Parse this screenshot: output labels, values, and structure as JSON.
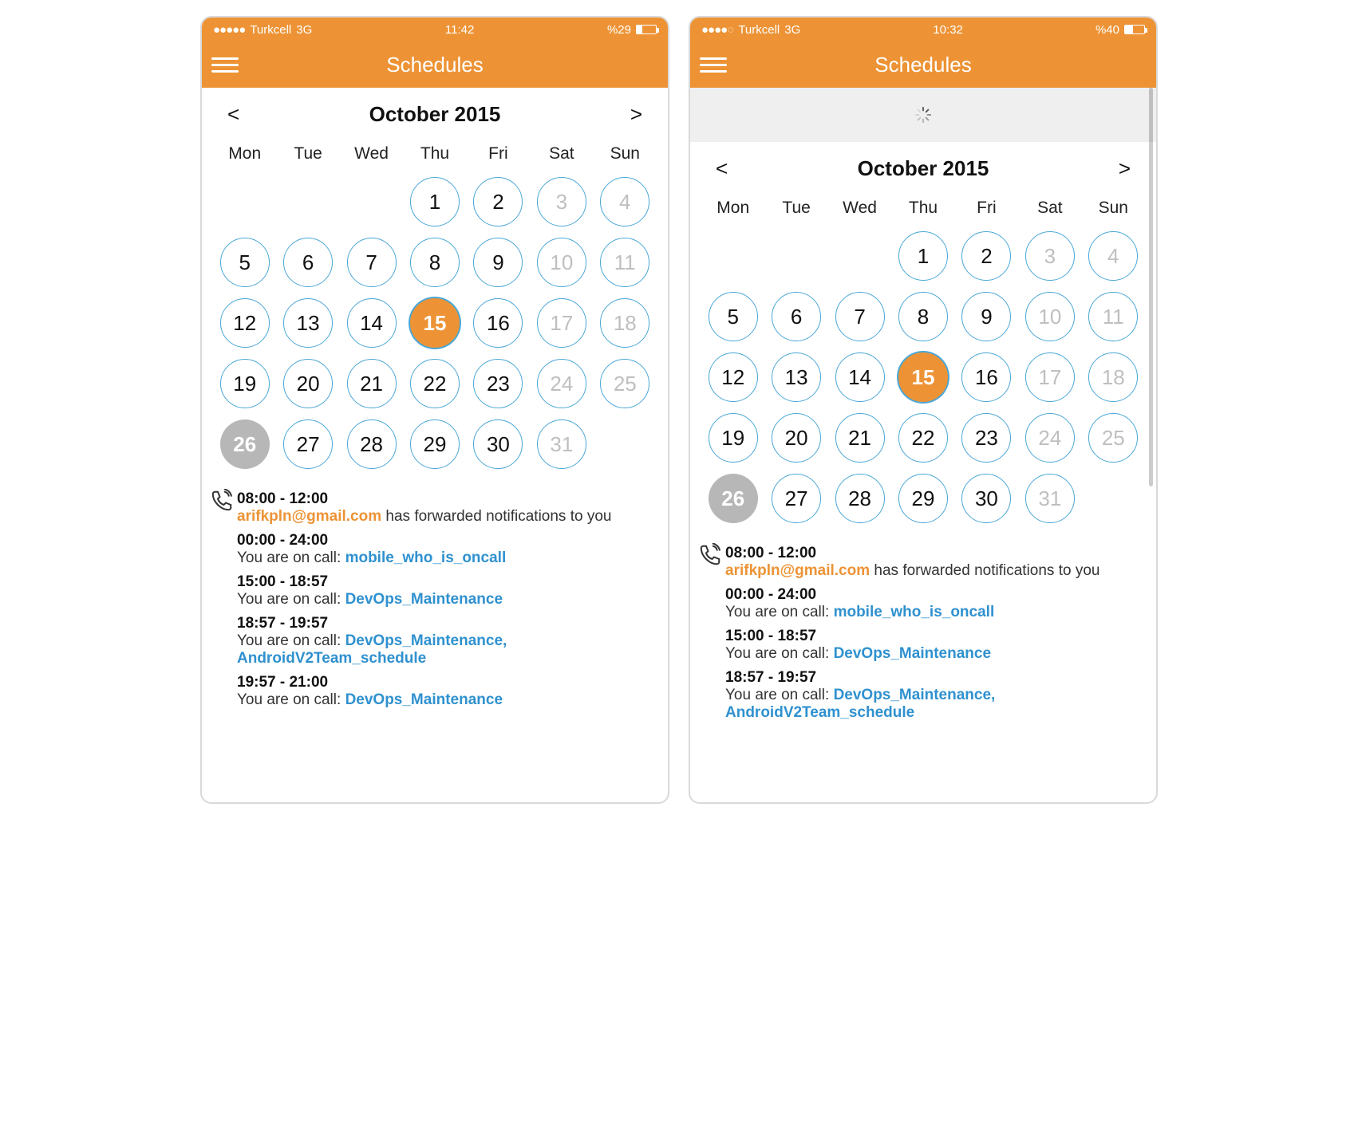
{
  "colors": {
    "accent": "#ed9335",
    "link": "#2f91cf",
    "ring": "#4aa7d6"
  },
  "screens": {
    "left": {
      "status": {
        "carrier": "Turkcell",
        "network": "3G",
        "time": "11:42",
        "battery_label": "%29",
        "battery_pct": 29,
        "signal_filled": 5
      },
      "nav_title": "Schedules",
      "month_title": "October 2015",
      "has_loading": false,
      "events": [
        {
          "time": "08:00 - 12:00",
          "segments": [
            {
              "t": "arifkpln@gmail.com",
              "c": "orange"
            },
            {
              "t": " has forwarded notifications to you",
              "c": ""
            }
          ]
        },
        {
          "time": "00:00 - 24:00",
          "segments": [
            {
              "t": "You are on call: ",
              "c": ""
            },
            {
              "t": "mobile_who_is_oncall",
              "c": "blue"
            }
          ]
        },
        {
          "time": "15:00 - 18:57",
          "segments": [
            {
              "t": "You are on call: ",
              "c": ""
            },
            {
              "t": "DevOps_Maintenance",
              "c": "blue"
            }
          ]
        },
        {
          "time": "18:57 - 19:57",
          "segments": [
            {
              "t": "You are on call: ",
              "c": ""
            },
            {
              "t": "DevOps_Maintenance, AndroidV2Team_schedule",
              "c": "blue"
            }
          ]
        },
        {
          "time": "19:57 - 21:00",
          "segments": [
            {
              "t": "You are on call: ",
              "c": ""
            },
            {
              "t": "DevOps_Maintenance",
              "c": "blue"
            }
          ]
        }
      ]
    },
    "right": {
      "status": {
        "carrier": "Turkcell",
        "network": "3G",
        "time": "10:32",
        "battery_label": "%40",
        "battery_pct": 40,
        "signal_filled": 4
      },
      "nav_title": "Schedules",
      "month_title": "October 2015",
      "has_loading": true,
      "events": [
        {
          "time": "08:00 - 12:00",
          "segments": [
            {
              "t": "arifkpln@gmail.com",
              "c": "orange"
            },
            {
              "t": " has forwarded notifications to you",
              "c": ""
            }
          ]
        },
        {
          "time": "00:00 - 24:00",
          "segments": [
            {
              "t": "You are on call: ",
              "c": ""
            },
            {
              "t": "mobile_who_is_oncall",
              "c": "blue"
            }
          ]
        },
        {
          "time": "15:00 - 18:57",
          "segments": [
            {
              "t": "You are on call: ",
              "c": ""
            },
            {
              "t": "DevOps_Maintenance",
              "c": "blue"
            }
          ]
        },
        {
          "time": "18:57 - 19:57",
          "segments": [
            {
              "t": "You are on call: ",
              "c": ""
            },
            {
              "t": "DevOps_Maintenance, AndroidV2Team_schedule",
              "c": "blue"
            }
          ]
        }
      ]
    }
  },
  "dow": [
    "Mon",
    "Tue",
    "Wed",
    "Thu",
    "Fri",
    "Sat",
    "Sun"
  ],
  "calendar": {
    "leading_blanks": 3,
    "days": [
      {
        "n": "1",
        "weekend": false
      },
      {
        "n": "2",
        "weekend": false
      },
      {
        "n": "3",
        "weekend": true
      },
      {
        "n": "4",
        "weekend": true
      },
      {
        "n": "5",
        "weekend": false
      },
      {
        "n": "6",
        "weekend": false
      },
      {
        "n": "7",
        "weekend": false
      },
      {
        "n": "8",
        "weekend": false
      },
      {
        "n": "9",
        "weekend": false
      },
      {
        "n": "10",
        "weekend": true
      },
      {
        "n": "11",
        "weekend": true
      },
      {
        "n": "12",
        "weekend": false
      },
      {
        "n": "13",
        "weekend": false
      },
      {
        "n": "14",
        "weekend": false
      },
      {
        "n": "15",
        "weekend": false,
        "selected": true
      },
      {
        "n": "16",
        "weekend": false
      },
      {
        "n": "17",
        "weekend": true
      },
      {
        "n": "18",
        "weekend": true
      },
      {
        "n": "19",
        "weekend": false
      },
      {
        "n": "20",
        "weekend": false
      },
      {
        "n": "21",
        "weekend": false
      },
      {
        "n": "22",
        "weekend": false
      },
      {
        "n": "23",
        "weekend": false
      },
      {
        "n": "24",
        "weekend": true
      },
      {
        "n": "25",
        "weekend": true
      },
      {
        "n": "26",
        "weekend": false,
        "today_off": true
      },
      {
        "n": "27",
        "weekend": false
      },
      {
        "n": "28",
        "weekend": false
      },
      {
        "n": "29",
        "weekend": false
      },
      {
        "n": "30",
        "weekend": false
      },
      {
        "n": "31",
        "weekend": true
      }
    ]
  }
}
